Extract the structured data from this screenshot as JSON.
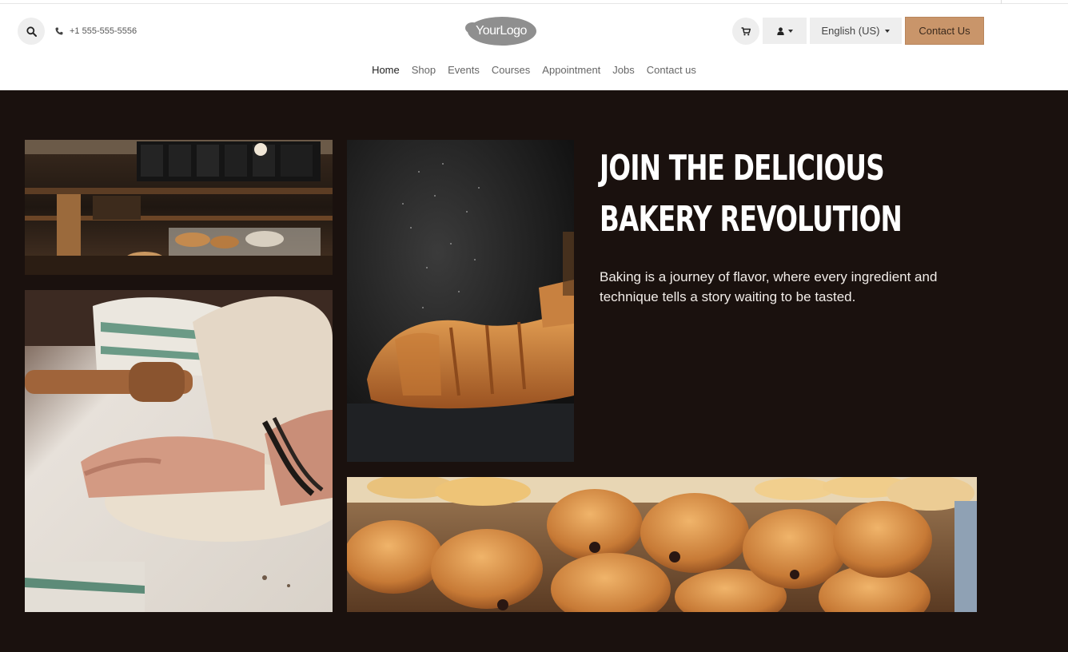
{
  "header": {
    "phone": "+1 555-555-5556",
    "logo_text": "YourLogo",
    "language": "English (US)",
    "contact_button": "Contact Us"
  },
  "nav": {
    "items": [
      {
        "label": "Home",
        "active": true
      },
      {
        "label": "Shop"
      },
      {
        "label": "Events"
      },
      {
        "label": "Courses"
      },
      {
        "label": "Appointment"
      },
      {
        "label": "Jobs"
      },
      {
        "label": "Contact us"
      }
    ]
  },
  "hero": {
    "title_line1": "Join the delicious",
    "title_line2": "bakery revolution",
    "text": "Baking is a journey of flavor, where every ingredient and technique tells a story waiting to be tasted."
  },
  "colors": {
    "hero_background": "#1a110e",
    "accent": "#c9956a"
  },
  "icons": [
    "search-icon",
    "phone-icon",
    "cart-icon",
    "user-icon",
    "chevron-down-icon"
  ]
}
